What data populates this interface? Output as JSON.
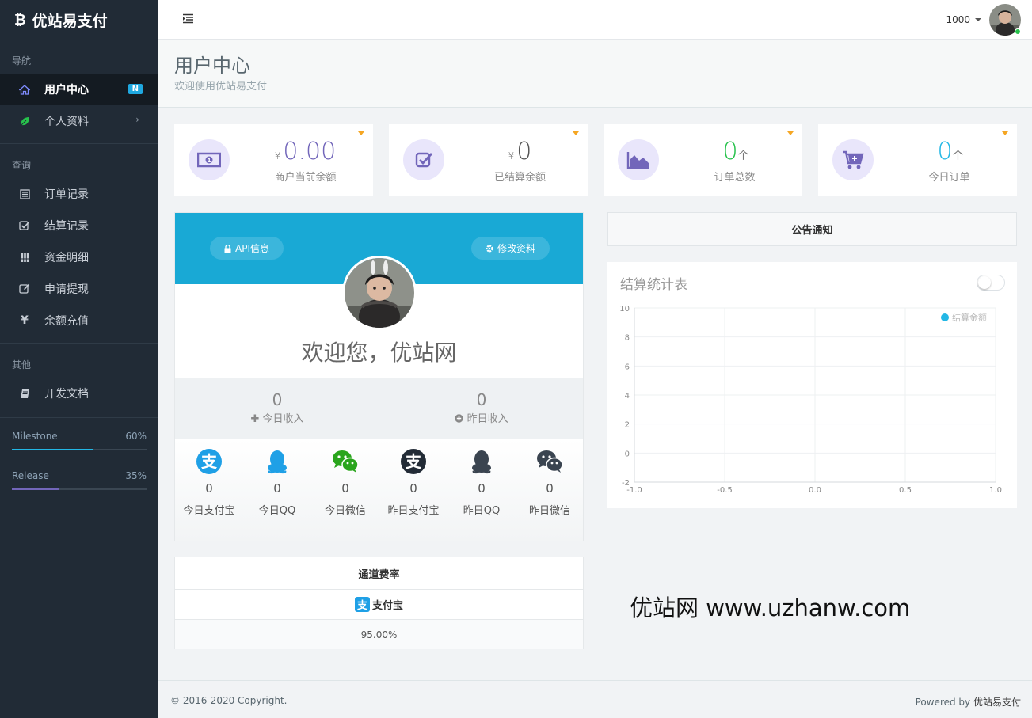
{
  "app": {
    "title": "优站易支付"
  },
  "sidebar": {
    "sections": [
      {
        "header": "导航",
        "items": [
          {
            "label": "用户中心",
            "badge": "N",
            "icon": "home-icon"
          },
          {
            "label": "个人资料",
            "icon": "leaf-icon"
          }
        ]
      },
      {
        "header": "查询",
        "items": [
          {
            "label": "订单记录",
            "icon": "list-icon"
          },
          {
            "label": "结算记录",
            "icon": "check-square-icon"
          },
          {
            "label": "资金明细",
            "icon": "grid-icon"
          },
          {
            "label": "申请提现",
            "icon": "edit-icon"
          },
          {
            "label": "余额充值",
            "icon": "yen-icon"
          }
        ]
      },
      {
        "header": "其他",
        "items": [
          {
            "label": "开发文档",
            "icon": "book-icon"
          }
        ]
      }
    ],
    "progress": [
      {
        "label": "Milestone",
        "value_text": "60%",
        "value": 60,
        "color": "#23b7e5"
      },
      {
        "label": "Release",
        "value_text": "35%",
        "value": 35,
        "color": "#7266ba"
      }
    ]
  },
  "topbar": {
    "username": "1000"
  },
  "page": {
    "title": "用户中心",
    "subtitle": "欢迎使用优站易支付"
  },
  "stats": [
    {
      "currency": "¥",
      "value": "0.00",
      "unit": "",
      "label": "商户当前余额",
      "icon": "money-icon",
      "color": "#7266ba"
    },
    {
      "currency": "¥",
      "value": "0",
      "unit": "",
      "label": "已结算余额",
      "icon": "check-square-icon",
      "color": "#555555"
    },
    {
      "currency": "",
      "value": "0",
      "unit": "个",
      "label": "订单总数",
      "icon": "area-chart-icon",
      "color": "#27c24c"
    },
    {
      "currency": "",
      "value": "0",
      "unit": "个",
      "label": "今日订单",
      "icon": "cart-plus-icon",
      "color": "#23b7e5"
    }
  ],
  "profile": {
    "api_button": "API信息",
    "edit_button": "修改资料",
    "welcome": "欢迎您，优站网",
    "income": [
      {
        "value": "0",
        "label": "今日收入",
        "icon": "plus-icon"
      },
      {
        "value": "0",
        "label": "昨日收入",
        "icon": "plus-circle-icon"
      }
    ],
    "payments": [
      {
        "value": "0",
        "label": "今日支付宝",
        "icon": "alipay-icon",
        "color": "#1fa0e6"
      },
      {
        "value": "0",
        "label": "今日QQ",
        "icon": "qq-icon",
        "color": "#1fa0e6"
      },
      {
        "value": "0",
        "label": "今日微信",
        "icon": "wechat-icon",
        "color": "#2aa51d"
      },
      {
        "value": "0",
        "label": "昨日支付宝",
        "icon": "alipay-icon",
        "color": "#222b36"
      },
      {
        "value": "0",
        "label": "昨日QQ",
        "icon": "qq-icon",
        "color": "#3a4450"
      },
      {
        "value": "0",
        "label": "昨日微信",
        "icon": "wechat-icon",
        "color": "#3a4450"
      }
    ]
  },
  "rate": {
    "title": "通道费率",
    "channel": "支付宝",
    "value": "95.00%"
  },
  "notice": {
    "title": "公告通知"
  },
  "chart": {
    "title": "结算统计表"
  },
  "chart_data": {
    "type": "line",
    "title": "结算统计表",
    "series": [
      {
        "name": "结算金额",
        "x": [],
        "y": [],
        "color": "#23b7e5"
      }
    ],
    "xlim": [
      -1.0,
      1.0
    ],
    "ylim": [
      -2,
      10
    ],
    "x_ticks": [
      "-1.0",
      "-0.5",
      "0.0",
      "0.5",
      "1.0"
    ],
    "y_ticks": [
      "10",
      "8",
      "6",
      "4",
      "2",
      "0",
      "-2"
    ],
    "grid": true,
    "legend": "top-right"
  },
  "watermark": "优站网 www.uzhanw.com",
  "footer": {
    "copyright": "© 2016-2020 Copyright.",
    "powered_prefix": "Powered by",
    "powered_brand": "优站易支付"
  }
}
